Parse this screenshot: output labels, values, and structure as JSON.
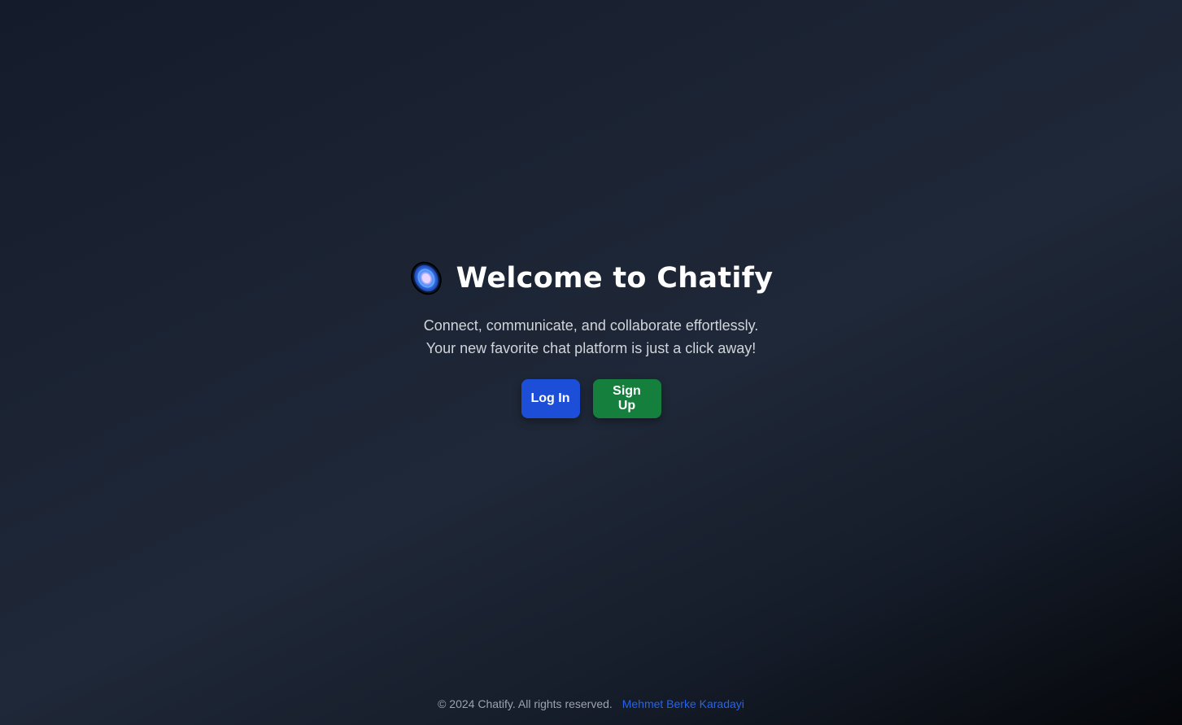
{
  "hero": {
    "logo_icon": "chatify-galaxy-icon",
    "title": "Welcome to Chatify",
    "subtitle_line1": "Connect, communicate, and collaborate effortlessly.",
    "subtitle_line2": "Your new favorite chat platform is just a click away!"
  },
  "actions": {
    "login_label": "Log In",
    "signup_label": "Sign Up",
    "login_color": "#1d4ed8",
    "signup_color": "#15803d"
  },
  "footer": {
    "copyright": "© 2024 Chatify. All rights reserved.",
    "author_link": "Mehmet Berke Karadayi",
    "link_color": "#2563eb"
  }
}
